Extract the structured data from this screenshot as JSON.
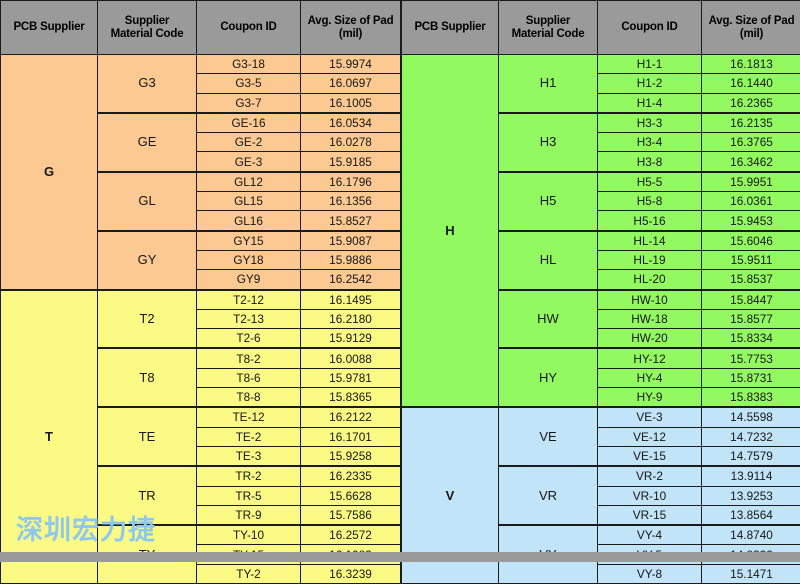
{
  "headers": {
    "supplier": "PCB Supplier",
    "material_code_line1": "Supplier",
    "material_code_line2": "Material Code",
    "coupon_id": "Coupon ID",
    "avg_pad_line1": "Avg. Size of Pad",
    "avg_pad_line2": "(mil)"
  },
  "watermark": "深圳宏力捷",
  "colors": {
    "header_gray": "#9a9a9a",
    "section_G": "#fbc991",
    "section_T": "#fafa85",
    "section_H": "#92f961",
    "section_V": "#c2e4f8",
    "border": "#1b1b1b",
    "watermark": "#8ec8ef"
  },
  "left_table": {
    "sections": [
      {
        "supplier": "G",
        "color_key": "section_G",
        "groups": [
          {
            "code": "G3",
            "rows": [
              {
                "coupon": "G3-18",
                "avg": "15.9974"
              },
              {
                "coupon": "G3-5",
                "avg": "16.0697"
              },
              {
                "coupon": "G3-7",
                "avg": "16.1005"
              }
            ]
          },
          {
            "code": "GE",
            "rows": [
              {
                "coupon": "GE-16",
                "avg": "16.0534"
              },
              {
                "coupon": "GE-2",
                "avg": "16.0278"
              },
              {
                "coupon": "GE-3",
                "avg": "15.9185"
              }
            ]
          },
          {
            "code": "GL",
            "rows": [
              {
                "coupon": "GL12",
                "avg": "16.1796"
              },
              {
                "coupon": "GL15",
                "avg": "16.1356"
              },
              {
                "coupon": "GL16",
                "avg": "15.8527"
              }
            ]
          },
          {
            "code": "GY",
            "rows": [
              {
                "coupon": "GY15",
                "avg": "15.9087"
              },
              {
                "coupon": "GY18",
                "avg": "15.9886"
              },
              {
                "coupon": "GY9",
                "avg": "16.2542"
              }
            ]
          }
        ]
      },
      {
        "supplier": "T",
        "color_key": "section_T",
        "groups": [
          {
            "code": "T2",
            "rows": [
              {
                "coupon": "T2-12",
                "avg": "16.1495"
              },
              {
                "coupon": "T2-13",
                "avg": "16.2180"
              },
              {
                "coupon": "T2-6",
                "avg": "15.9129"
              }
            ]
          },
          {
            "code": "T8",
            "rows": [
              {
                "coupon": "T8-2",
                "avg": "16.0088"
              },
              {
                "coupon": "T8-6",
                "avg": "15.9781"
              },
              {
                "coupon": "T8-8",
                "avg": "15.8365"
              }
            ]
          },
          {
            "code": "TE",
            "rows": [
              {
                "coupon": "TE-12",
                "avg": "16.2122"
              },
              {
                "coupon": "TE-2",
                "avg": "16.1701"
              },
              {
                "coupon": "TE-3",
                "avg": "15.9258"
              }
            ]
          },
          {
            "code": "TR",
            "rows": [
              {
                "coupon": "TR-2",
                "avg": "16.2335"
              },
              {
                "coupon": "TR-5",
                "avg": "15.6628"
              },
              {
                "coupon": "TR-9",
                "avg": "15.7586"
              }
            ]
          },
          {
            "code": "TY",
            "rows": [
              {
                "coupon": "TY-10",
                "avg": "16.2572"
              },
              {
                "coupon": "TY-15",
                "avg": "16.1083"
              },
              {
                "coupon": "TY-2",
                "avg": "16.3239"
              }
            ]
          }
        ]
      }
    ]
  },
  "right_table": {
    "sections": [
      {
        "supplier": "H",
        "color_key": "section_H",
        "groups": [
          {
            "code": "H1",
            "rows": [
              {
                "coupon": "H1-1",
                "avg": "16.1813"
              },
              {
                "coupon": "H1-2",
                "avg": "16.1440"
              },
              {
                "coupon": "H1-4",
                "avg": "16.2365"
              }
            ]
          },
          {
            "code": "H3",
            "rows": [
              {
                "coupon": "H3-3",
                "avg": "16.2135"
              },
              {
                "coupon": "H3-4",
                "avg": "16.3765"
              },
              {
                "coupon": "H3-8",
                "avg": "16.3462"
              }
            ]
          },
          {
            "code": "H5",
            "rows": [
              {
                "coupon": "H5-5",
                "avg": "15.9951"
              },
              {
                "coupon": "H5-8",
                "avg": "16.0361"
              },
              {
                "coupon": "H5-16",
                "avg": "15.9453"
              }
            ]
          },
          {
            "code": "HL",
            "rows": [
              {
                "coupon": "HL-14",
                "avg": "15.6046"
              },
              {
                "coupon": "HL-19",
                "avg": "15.9511"
              },
              {
                "coupon": "HL-20",
                "avg": "15.8537"
              }
            ]
          },
          {
            "code": "HW",
            "rows": [
              {
                "coupon": "HW-10",
                "avg": "15.8447"
              },
              {
                "coupon": "HW-18",
                "avg": "15.8577"
              },
              {
                "coupon": "HW-20",
                "avg": "15.8334"
              }
            ]
          },
          {
            "code": "HY",
            "rows": [
              {
                "coupon": "HY-12",
                "avg": "15.7753"
              },
              {
                "coupon": "HY-4",
                "avg": "15.8731"
              },
              {
                "coupon": "HY-9",
                "avg": "15.8383"
              }
            ]
          }
        ]
      },
      {
        "supplier": "V",
        "color_key": "section_V",
        "groups": [
          {
            "code": "VE",
            "rows": [
              {
                "coupon": "VE-3",
                "avg": "14.5598"
              },
              {
                "coupon": "VE-12",
                "avg": "14.7232"
              },
              {
                "coupon": "VE-15",
                "avg": "14.7579"
              }
            ]
          },
          {
            "code": "VR",
            "rows": [
              {
                "coupon": "VR-2",
                "avg": "13.9114"
              },
              {
                "coupon": "VR-10",
                "avg": "13.9253"
              },
              {
                "coupon": "VR-15",
                "avg": "13.8564"
              }
            ]
          },
          {
            "code": "VY",
            "rows": [
              {
                "coupon": "VY-4",
                "avg": "14.8740"
              },
              {
                "coupon": "VY-5",
                "avg": "14.8332"
              },
              {
                "coupon": "VY-8",
                "avg": "15.1471"
              }
            ]
          }
        ]
      }
    ]
  }
}
